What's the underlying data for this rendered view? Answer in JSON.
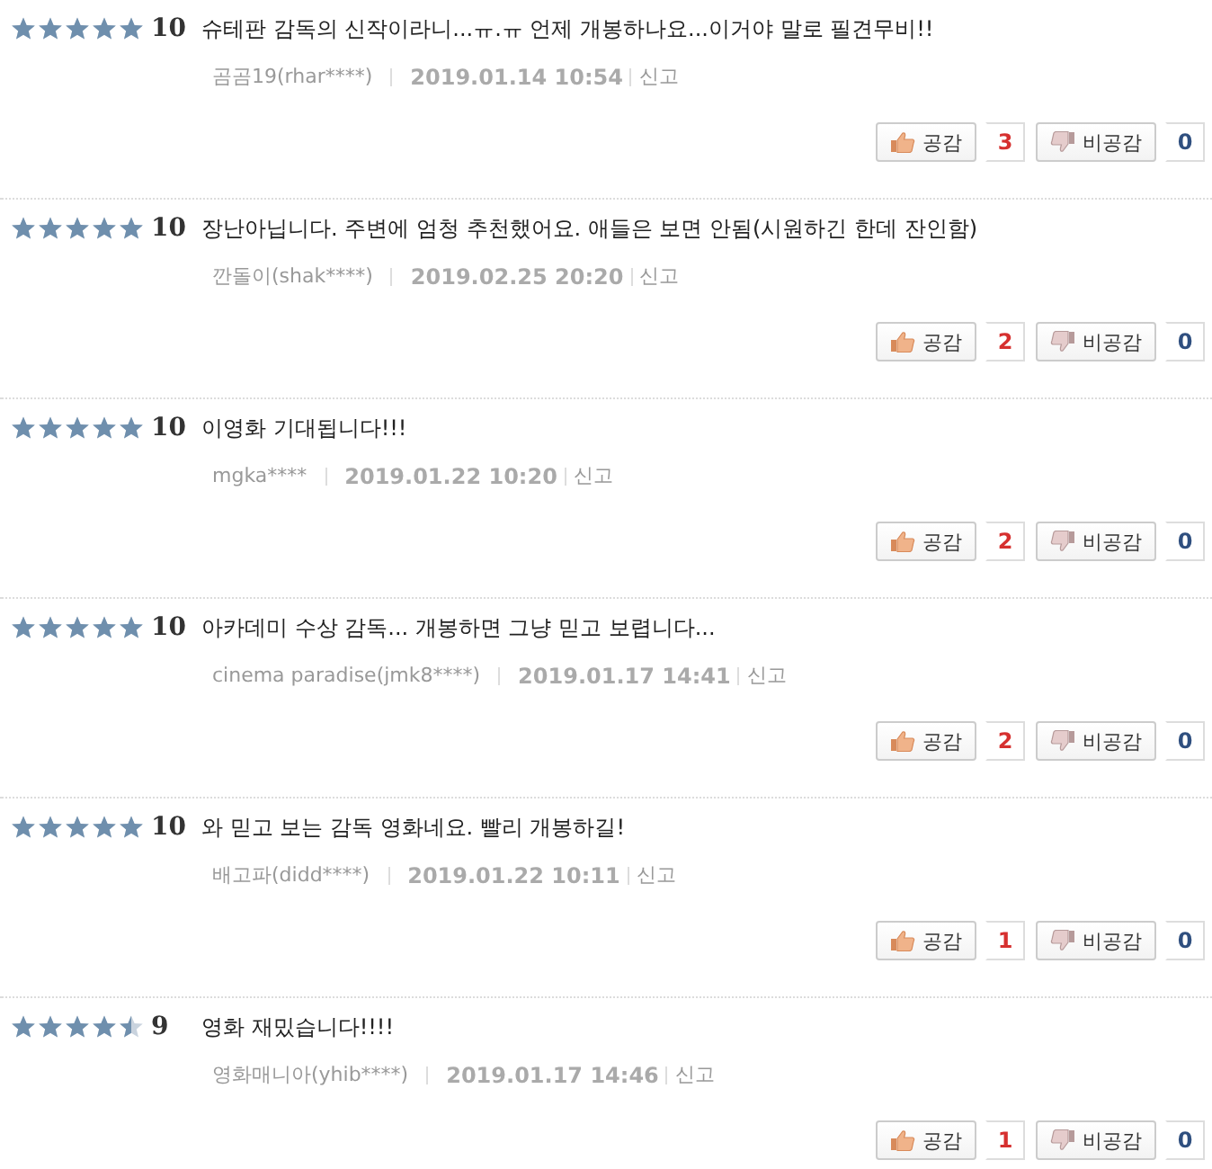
{
  "reviews": [
    {
      "stars": 5,
      "score": "10",
      "text": "슈테판 감독의 신작이라니...ㅠ.ㅠ 언제 개봉하나요...이거야 말로 필견무비!!",
      "author": "곰곰19(rhar****)",
      "date": "2019.01.14 10:54",
      "report": "신고",
      "like_label": "공감",
      "likes": "3",
      "dislike_label": "비공감",
      "dislikes": "0"
    },
    {
      "stars": 5,
      "score": "10",
      "text": "장난아닙니다. 주변에 엄청 추천했어요. 애들은 보면 안됨(시원하긴 한데 잔인함)",
      "author": "깐돌이(shak****)",
      "date": "2019.02.25 20:20",
      "report": "신고",
      "like_label": "공감",
      "likes": "2",
      "dislike_label": "비공감",
      "dislikes": "0"
    },
    {
      "stars": 5,
      "score": "10",
      "text": "이영화 기대됩니다!!!",
      "author": "mgka****",
      "date": "2019.01.22 10:20",
      "report": "신고",
      "like_label": "공감",
      "likes": "2",
      "dislike_label": "비공감",
      "dislikes": "0"
    },
    {
      "stars": 5,
      "score": "10",
      "text": "아카데미 수상 감독... 개봉하면 그냥 믿고 보렵니다...",
      "author": "cinema paradise(jmk8****)",
      "date": "2019.01.17 14:41",
      "report": "신고",
      "like_label": "공감",
      "likes": "2",
      "dislike_label": "비공감",
      "dislikes": "0"
    },
    {
      "stars": 5,
      "score": "10",
      "text": "와 믿고 보는 감독 영화네요. 빨리 개봉하길!",
      "author": "배고파(didd****)",
      "date": "2019.01.22 10:11",
      "report": "신고",
      "like_label": "공감",
      "likes": "1",
      "dislike_label": "비공감",
      "dislikes": "0"
    },
    {
      "stars": 4.5,
      "score": "9",
      "text": "영화 재밌습니다!!!!",
      "author": "영화매니아(yhib****)",
      "date": "2019.01.17 14:46",
      "report": "신고",
      "like_label": "공감",
      "likes": "1",
      "dislike_label": "비공감",
      "dislikes": "0"
    }
  ]
}
